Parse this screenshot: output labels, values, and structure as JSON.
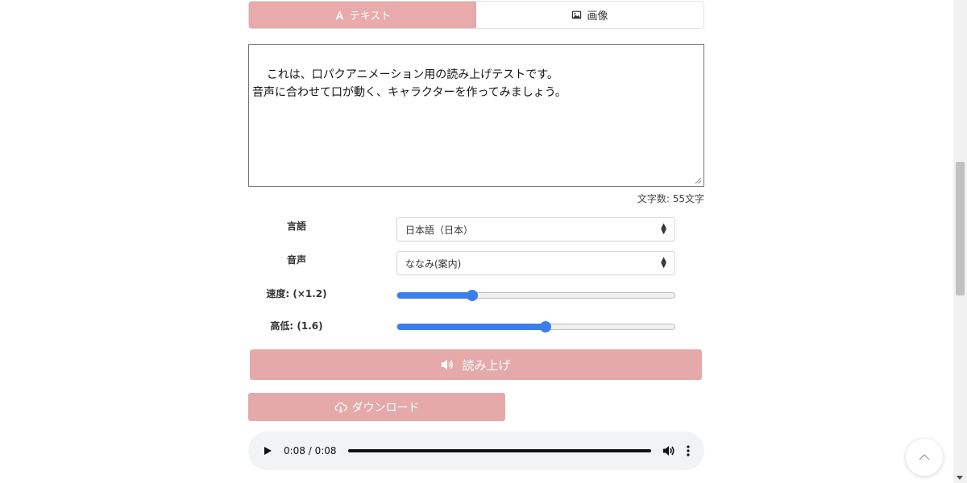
{
  "tabs": [
    {
      "label": "テキスト",
      "icon": "font-icon",
      "active": true
    },
    {
      "label": "画像",
      "icon": "image-icon",
      "active": false
    }
  ],
  "textarea": {
    "value": "これは、口パクアニメーション用の読み上げテストです。\n音声に合わせて口が動く、キャラクターを作ってみましょう。"
  },
  "char_count": "文字数: 55文字",
  "form": {
    "language": {
      "label": "言語",
      "value": "日本語（日本）"
    },
    "voice": {
      "label": "音声",
      "value": "ななみ(案内)"
    },
    "speed": {
      "label": "速度: (×1.2)",
      "fraction": 0.27
    },
    "pitch": {
      "label": "高低: (1.6)",
      "fraction": 0.535
    }
  },
  "buttons": {
    "read_label": "読み上げ",
    "download_label": "ダウンロード"
  },
  "audio": {
    "time": "0:08 / 0:08",
    "progress": 1.0
  },
  "colors": {
    "accent": "#e5a9a9",
    "slider": "#3b7de9"
  }
}
